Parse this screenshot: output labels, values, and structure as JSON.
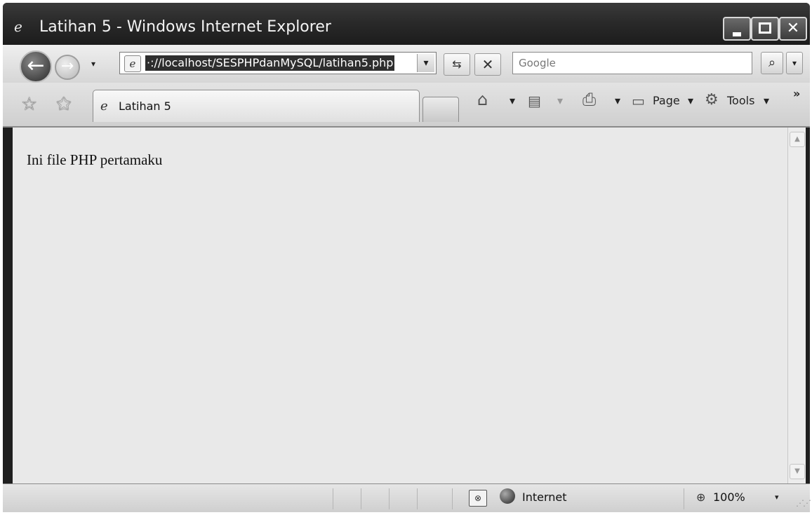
{
  "window": {
    "title": "Latihan 5 - Windows Internet Explorer",
    "title_icon": "e"
  },
  "navbar": {
    "back_icon": "←",
    "forward_icon": "→",
    "dropdown_icon": "▾",
    "address_icon": "e",
    "address_url": "·://localhost/SESPHPdanMySQL/latihan5.php",
    "address_dropdown_icon": "▾",
    "refresh_icon": "⇆",
    "stop_icon": "✕",
    "search_placeholder": "Google",
    "search_icon": "⌕",
    "search_dropdown_icon": "▾"
  },
  "tabbar": {
    "favorites_icon": "☆",
    "add_favorites_icon": "✩",
    "tab_label": "Latihan 5",
    "home_icon": "⌂",
    "home_dd": "▾",
    "feeds_icon": "▤",
    "feeds_dd": "▾",
    "print_icon": "⎙",
    "print_dd": "▾",
    "page_label": "Page",
    "page_dd": "▾",
    "tools_label": "Tools",
    "tools_dd": "▾",
    "chevron": "»"
  },
  "content": {
    "text": "Ini file PHP pertamaku"
  },
  "scrollbar": {
    "up_icon": "▲",
    "down_icon": "▼"
  },
  "statusbar": {
    "protected_icon": "⊗",
    "zone_label": "Internet",
    "zoom_icon": "⊕",
    "zoom_label": "100%",
    "zoom_dd": "▾",
    "grip": "⋰⋰"
  }
}
